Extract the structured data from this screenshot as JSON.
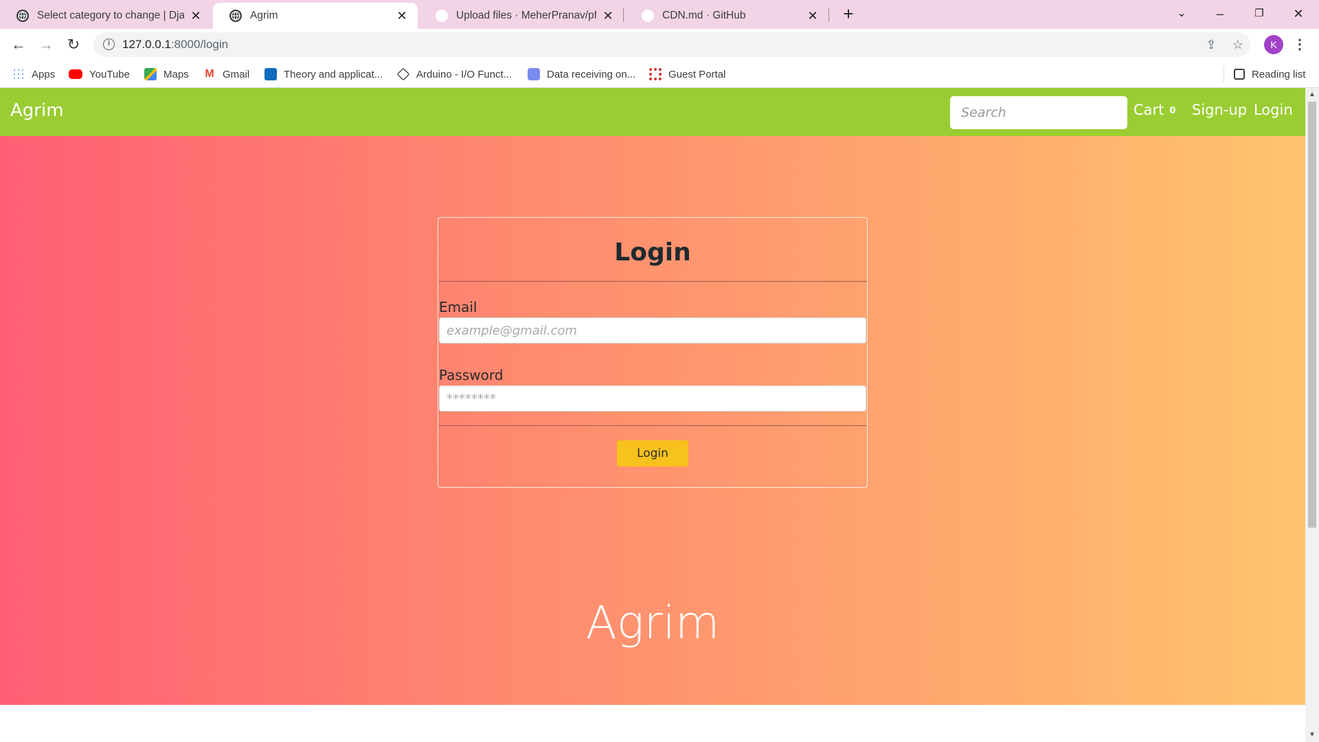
{
  "browser": {
    "tabs": [
      {
        "title": "Select category to change | Django",
        "favicon": "globe-icon",
        "active": false
      },
      {
        "title": "Agrim",
        "favicon": "globe-icon",
        "active": true
      },
      {
        "title": "Upload files · MeherPranav/pfsd",
        "favicon": "github-icon",
        "active": false
      },
      {
        "title": "CDN.md · GitHub",
        "favicon": "github-icon",
        "active": false
      }
    ],
    "url": {
      "host": "127.0.0.1",
      "path": ":8000/login"
    },
    "profile_initial": "K",
    "bookmarks": [
      {
        "label": "Apps",
        "icon": "apps-grid-icon"
      },
      {
        "label": "YouTube",
        "icon": "youtube-icon"
      },
      {
        "label": "Maps",
        "icon": "maps-icon"
      },
      {
        "label": "Gmail",
        "icon": "gmail-icon"
      },
      {
        "label": "Theory and applicat...",
        "icon": "outlook-icon"
      },
      {
        "label": "Arduino - I/O Funct...",
        "icon": "arduino-icon"
      },
      {
        "label": "Data receiving on...",
        "icon": "discord-icon"
      },
      {
        "label": "Guest Portal",
        "icon": "portal-icon"
      }
    ],
    "reading_list": "Reading list"
  },
  "site": {
    "brand": "Agrim",
    "search_placeholder": "Search",
    "cart_label": "Cart",
    "cart_count": "0",
    "signup_label": "Sign-up",
    "login_label": "Login",
    "nav_color": "#9acd32",
    "gradient": [
      "#ff5f74",
      "#ffc46d"
    ]
  },
  "login_card": {
    "title": "Login",
    "email_label": "Email",
    "email_placeholder": "example@gmail.com",
    "password_label": "Password",
    "password_placeholder": "********",
    "submit_label": "Login",
    "button_color": "#f8c21c"
  },
  "hero_title": "Agrim"
}
